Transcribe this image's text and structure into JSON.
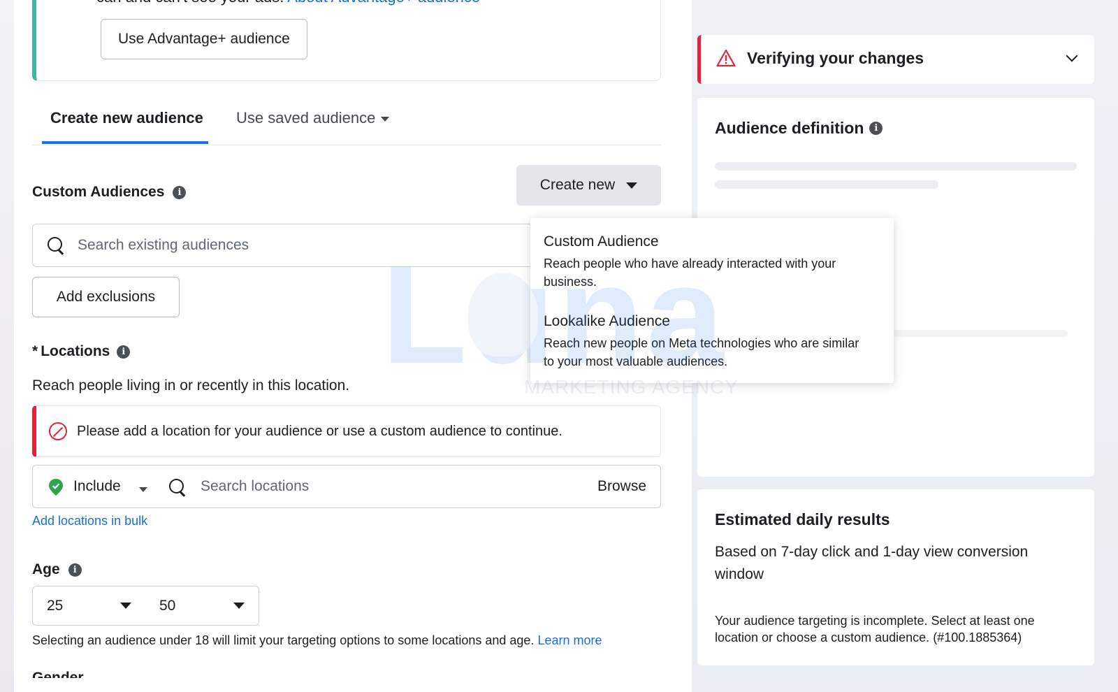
{
  "advantage": {
    "cut_text": "can and can't see your ads.",
    "cut_link": "About Advantage+ audience",
    "button_label": "Use Advantage+ audience"
  },
  "tabs": {
    "active_label": "Create new audience",
    "saved_label": "Use saved audience"
  },
  "custom_audiences": {
    "title": "Custom Audiences",
    "create_label": "Create new",
    "search_placeholder": "Search existing audiences",
    "exclusions_label": "Add exclusions"
  },
  "dropdown": {
    "items": [
      {
        "title": "Custom Audience",
        "desc": "Reach people who have already interacted with your business."
      },
      {
        "title": "Lookalike Audience",
        "desc": "Reach new people on Meta technologies who are similar to your most valuable audiences."
      }
    ]
  },
  "locations": {
    "title": "Locations",
    "required_mark": "*",
    "desc": "Reach people living in or recently in this location.",
    "error": "Please add a location for your audience or use a custom audience to continue.",
    "include_label": "Include",
    "search_placeholder": "Search locations",
    "browse_label": "Browse",
    "bulk_link": "Add locations in bulk"
  },
  "age": {
    "title": "Age",
    "min": "25",
    "max": "50",
    "note": "Selecting an audience under 18 will limit your targeting options to some locations and age.",
    "learn_more": "Learn more"
  },
  "next_section": {
    "title": "Gender"
  },
  "watermark": {
    "text": "Luna",
    "sub": "MARKETING AGENCY"
  },
  "verify": {
    "title": "Verifying your changes"
  },
  "definition": {
    "title": "Audience definition"
  },
  "estimate": {
    "title": "Estimated daily results",
    "desc": "Based on 7-day click and 1-day view conversion window",
    "note": "Your audience targeting is incomplete. Select at least one location or choose a custom audience. (#100.1885364)"
  },
  "colors": {
    "accent_blue": "#1b74e4",
    "error_red": "#e0243c",
    "advantage_green": "#3fb6a0",
    "include_green": "#2ea44f"
  }
}
